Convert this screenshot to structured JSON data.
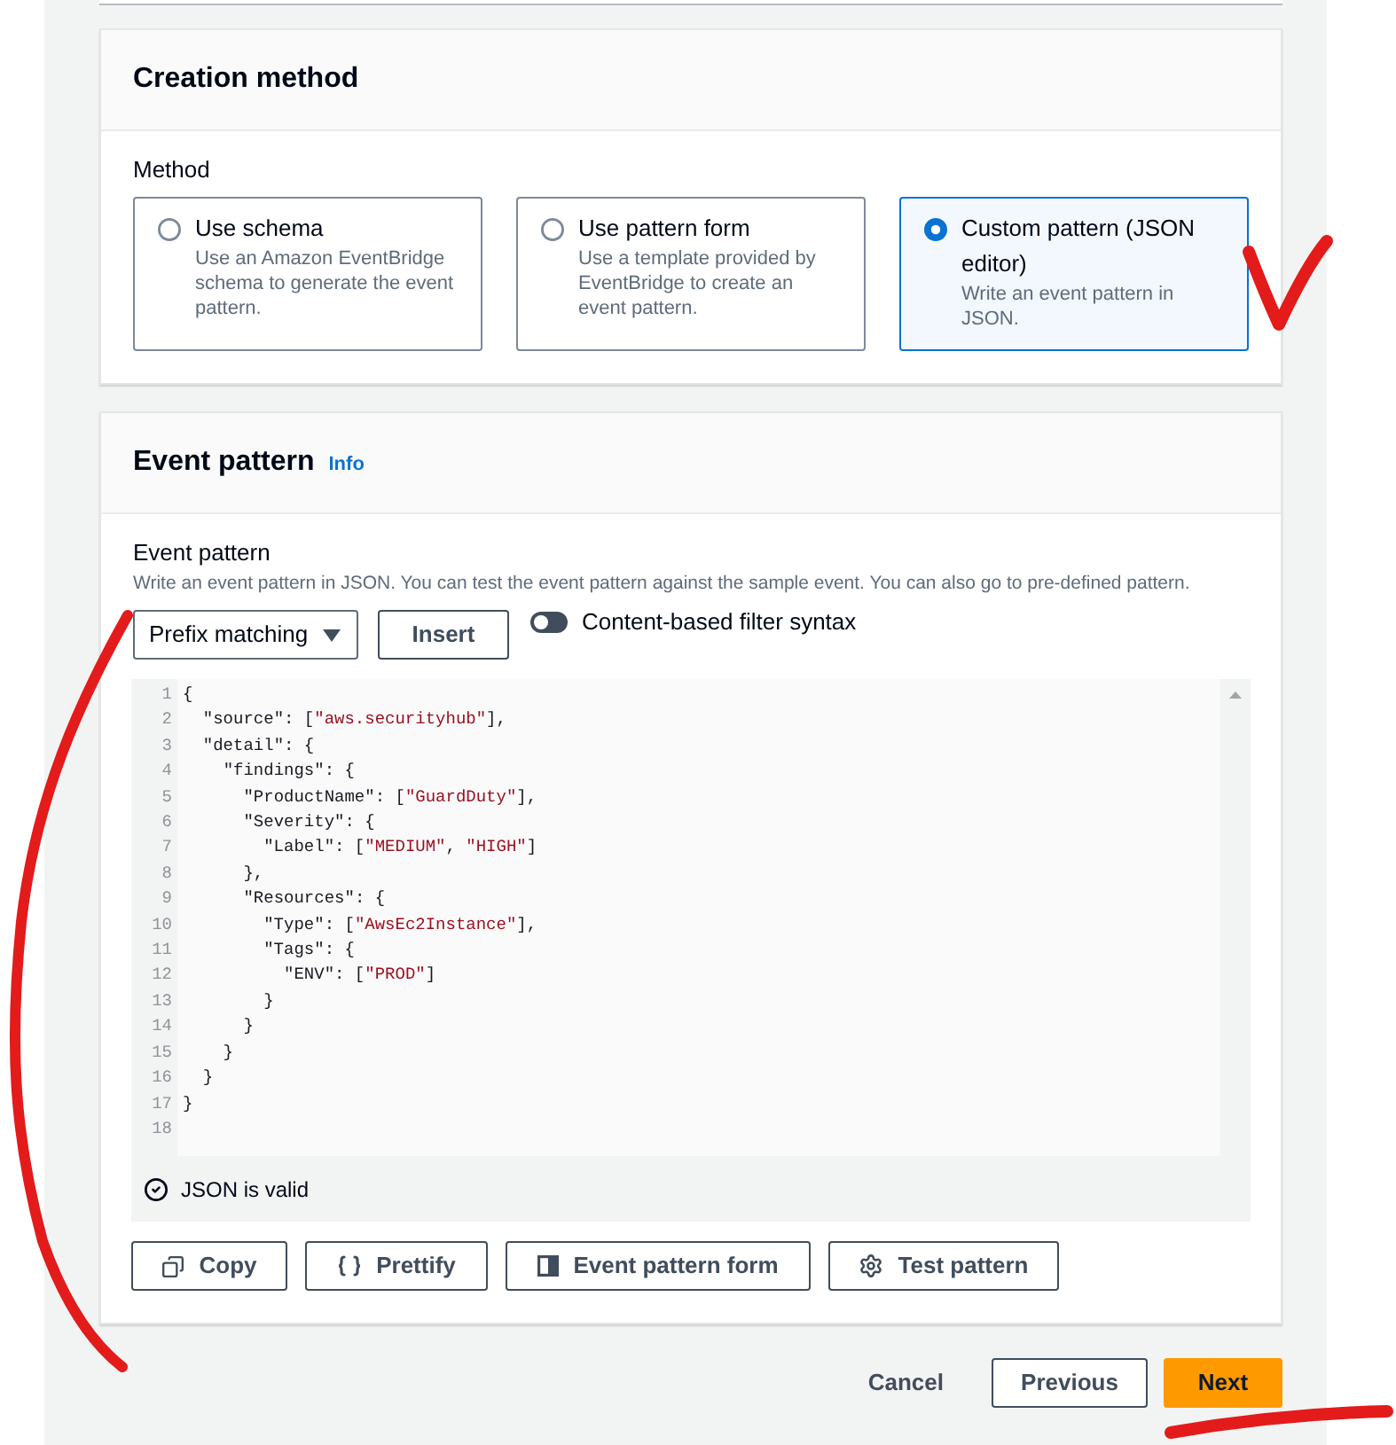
{
  "creation_method": {
    "title": "Creation method",
    "field_label": "Method",
    "options": [
      {
        "title": "Use schema",
        "description": "Use an Amazon EventBridge schema to generate the event pattern.",
        "selected": false
      },
      {
        "title": "Use pattern form",
        "description": "Use a template provided by EventBridge to create an event pattern.",
        "selected": false
      },
      {
        "title": "Custom pattern (JSON editor)",
        "description": "Write an event pattern in JSON.",
        "selected": true
      }
    ]
  },
  "event_pattern": {
    "title": "Event pattern",
    "info_link": "Info",
    "field_label": "Event pattern",
    "description": "Write an event pattern in JSON. You can test the event pattern against the sample event. You can also go to pre-defined pattern.",
    "matching_select": {
      "value": "Prefix matching"
    },
    "insert_button": "Insert",
    "filter_toggle": {
      "label": "Content-based filter syntax",
      "on": false
    },
    "editor": {
      "lines": [
        {
          "number": "1",
          "text": "{"
        },
        {
          "number": "2",
          "text": "  \"source\": [\"aws.securityhub\"],"
        },
        {
          "number": "3",
          "text": "  \"detail\": {"
        },
        {
          "number": "4",
          "text": "    \"findings\": {"
        },
        {
          "number": "5",
          "text": "      \"ProductName\": [\"GuardDuty\"],"
        },
        {
          "number": "6",
          "text": "      \"Severity\": {"
        },
        {
          "number": "7",
          "text": "        \"Label\": [\"MEDIUM\", \"HIGH\"]"
        },
        {
          "number": "8",
          "text": "      },"
        },
        {
          "number": "9",
          "text": "      \"Resources\": {"
        },
        {
          "number": "10",
          "text": "        \"Type\": [\"AwsEc2Instance\"],"
        },
        {
          "number": "11",
          "text": "        \"Tags\": {"
        },
        {
          "number": "12",
          "text": "          \"ENV\": [\"PROD\"]"
        },
        {
          "number": "13",
          "text": "        }"
        },
        {
          "number": "14",
          "text": "      }"
        },
        {
          "number": "15",
          "text": "    }"
        },
        {
          "number": "16",
          "text": "  }"
        },
        {
          "number": "17",
          "text": "}"
        },
        {
          "number": "18"
        }
      ],
      "validation": "JSON is valid"
    },
    "actions": [
      {
        "label": "Copy",
        "kind": "copy"
      },
      {
        "label": "Prettify",
        "kind": "prettify"
      },
      {
        "label": "Event pattern form",
        "kind": "form"
      },
      {
        "label": "Test pattern",
        "kind": "test"
      }
    ]
  },
  "footer": {
    "buttons": [
      {
        "label": "Cancel",
        "kind": "link"
      },
      {
        "label": "Previous",
        "kind": "secondary"
      },
      {
        "label": "Next",
        "kind": "primary"
      }
    ]
  }
}
